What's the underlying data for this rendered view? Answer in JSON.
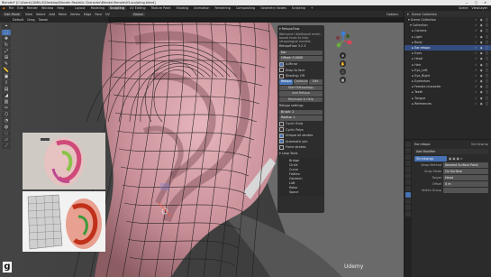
{
  "window": {
    "title": "Blender* [C:\\Users\\CAMILLE\\Desktop\\Blender Realistic Character\\Blender\\female\\03-sculpting.blend]",
    "controls": "— ▢ ✕"
  },
  "menubar": {
    "logo": "◆",
    "menus": [
      "File",
      "Edit",
      "Render",
      "Window",
      "Help"
    ],
    "workspaces": [
      "Layout",
      "Modeling",
      "Sculpting",
      "UV Editing",
      "Texture Paint",
      "Shading",
      "Animation",
      "Rendering",
      "Compositing",
      "Geometry Nodes",
      "Scripting",
      "+"
    ],
    "active_workspace": "Sculpting",
    "scene": "Scene",
    "view_layer": "ViewLayer"
  },
  "viewport_header": {
    "mode": "Edit Mode",
    "menus": [
      "View",
      "Select",
      "Add",
      "Mesh",
      "Vertex",
      "Edge",
      "Face",
      "UV"
    ],
    "orientation": "Global",
    "sub_orientation": "Default",
    "drag": "Drag",
    "tweak": "Tweak",
    "options": "Options"
  },
  "toolbar": {
    "tools": [
      "cursor-icon",
      "select-icon",
      "move-icon",
      "rotate-icon",
      "scale-icon",
      "transform-icon",
      "annotate-icon",
      "measure-icon",
      "add-cube-icon",
      "extrude-icon",
      "inset-icon",
      "bevel-icon",
      "loopcut-icon",
      "knife-icon",
      "polybuild-icon",
      "spin-icon",
      "smooth-icon",
      "shrink-icon",
      "shear-icon",
      "rip-icon"
    ]
  },
  "retopo_panel": {
    "header": "▾ RetopoFlow",
    "desc": "Welcome! Additional mesh-based tools to help retopologize models.",
    "version_label": "RetopoFlow 3.2.3",
    "rows": [
      {
        "type": "field",
        "text": "Ear"
      },
      {
        "type": "field",
        "text": "Offset: 0.0000"
      },
      {
        "type": "chk",
        "on": true,
        "text": "X-Mirror"
      },
      {
        "type": "chk",
        "on": false,
        "text": "Snap to face"
      },
      {
        "type": "chk",
        "on": false,
        "text": "Shading: Off"
      }
    ],
    "tabs": [
      "Retopo",
      "Contours",
      "Edit"
    ],
    "active_tab": 0,
    "buttons": [
      "Start Retopology",
      "Add Retopo",
      "Keymaps & Help"
    ],
    "sub_header": "Retopo settings",
    "more": [
      {
        "type": "field",
        "text": "Brush: 1"
      },
      {
        "type": "field",
        "text": "Radius: 1"
      },
      {
        "type": "chk",
        "on": false,
        "text": "Cyclic Ends"
      },
      {
        "type": "chk",
        "on": false,
        "text": "Cyclic Polys"
      },
      {
        "type": "chk",
        "on": true,
        "text": "Unique all strokes"
      },
      {
        "type": "chk",
        "on": true,
        "text": "Automatic join"
      },
      {
        "type": "chk",
        "on": false,
        "text": "Force strokes"
      }
    ],
    "list_header": "▾ Loop Tools",
    "list": [
      "Bridge",
      "Circle",
      "Curve",
      "Flatten",
      "Gstretch",
      "Loft",
      "Relax",
      "Space"
    ]
  },
  "reference_images": {
    "ref1_name": "ear reference 01",
    "ref2_name": "ear reference 02"
  },
  "badges": {
    "g_logo": "g",
    "watermark": "Udemy"
  },
  "nav": {
    "axis_x": "X",
    "axis_y": "Y",
    "axis_z": "Z",
    "buttons": [
      "⊕",
      "✋",
      "🎥",
      "▦"
    ]
  },
  "outliner": {
    "title": "Scene Collection",
    "search_placeholder": "",
    "rows": [
      {
        "indent": "",
        "label": "▾ Scene Collection",
        "sel": false
      },
      {
        "indent": "  ",
        "label": "▾ Collection",
        "sel": false
      },
      {
        "indent": "    ",
        "label": "▸ Camera",
        "sel": false
      },
      {
        "indent": "    ",
        "label": "▸ Light",
        "sel": false
      },
      {
        "indent": "    ",
        "label": "▸ Body",
        "sel": false
      },
      {
        "indent": "    ",
        "label": "▸ Ear.retopo",
        "sel": true
      },
      {
        "indent": "    ",
        "label": "▸ Eyes",
        "sel": false
      },
      {
        "indent": "    ",
        "label": "▸ Head",
        "sel": false
      },
      {
        "indent": "    ",
        "label": "▸ Hair",
        "sel": false
      },
      {
        "indent": "    ",
        "label": "▸ Eye_Left",
        "sel": false
      },
      {
        "indent": "    ",
        "label": "▸ Eye_Right",
        "sel": false
      },
      {
        "indent": "    ",
        "label": "▸ Eyelashes",
        "sel": false
      },
      {
        "indent": "    ",
        "label": "▸ Female.character",
        "sel": false
      },
      {
        "indent": "    ",
        "label": "▸ Teeth",
        "sel": false
      },
      {
        "indent": "    ",
        "label": "▸ Tongue",
        "sel": false
      },
      {
        "indent": "    ",
        "label": "▸ References",
        "sel": false
      }
    ],
    "vis": "✓ ◉ ▢"
  },
  "properties": {
    "object": "Ear.retopo",
    "modifier_label": "Shrinkwrap",
    "add_modifier": "Add Modifier",
    "modifier_name": "Shrinkwrap",
    "rows": [
      {
        "lbl": "Wrap Method",
        "val": "Nearest Surface Point",
        "blue": false
      },
      {
        "lbl": "Snap Mode",
        "val": "On Surface",
        "blue": false
      },
      {
        "lbl": "Target",
        "val": "Head",
        "blue": false
      },
      {
        "lbl": "Offset",
        "val": "0 m",
        "blue": false
      },
      {
        "lbl": "Vertex Group",
        "val": "",
        "blue": false
      }
    ]
  },
  "colors": {
    "accent": "#4772b3",
    "brand": "#e87d0d",
    "mesh_face": "#d8a0a8",
    "mesh_edge": "#1a1a1a"
  }
}
